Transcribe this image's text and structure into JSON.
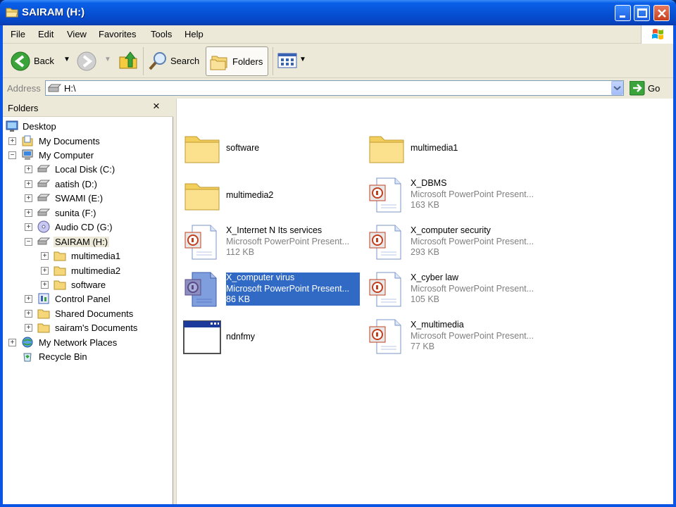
{
  "window": {
    "title": "SAIRAM (H:)"
  },
  "menu": [
    "File",
    "Edit",
    "View",
    "Favorites",
    "Tools",
    "Help"
  ],
  "toolbar": {
    "back_label": "Back",
    "search_label": "Search",
    "folders_label": "Folders"
  },
  "address": {
    "label": "Address",
    "value": "H:\\",
    "go_label": "Go"
  },
  "folders_pane": {
    "title": "Folders",
    "close_glyph": "×",
    "tree": [
      {
        "label": "Desktop",
        "icon": "desktop-icon"
      },
      {
        "label": "My Documents",
        "icon": "my-documents-icon"
      },
      {
        "label": "My Computer",
        "icon": "my-computer-icon"
      },
      {
        "label": "Local Disk (C:)",
        "icon": "drive-icon"
      },
      {
        "label": "aatish (D:)",
        "icon": "drive-icon"
      },
      {
        "label": "SWAMI (E:)",
        "icon": "drive-icon"
      },
      {
        "label": "sunita (F:)",
        "icon": "drive-icon"
      },
      {
        "label": "Audio CD (G:)",
        "icon": "cd-drive-icon"
      },
      {
        "label": "SAIRAM (H:)",
        "icon": "drive-icon"
      },
      {
        "label": "multimedia1",
        "icon": "folder-icon"
      },
      {
        "label": "multimedia2",
        "icon": "folder-icon"
      },
      {
        "label": "software",
        "icon": "folder-icon"
      },
      {
        "label": "Control Panel",
        "icon": "control-panel-icon"
      },
      {
        "label": "Shared Documents",
        "icon": "folder-icon"
      },
      {
        "label": "sairam's Documents",
        "icon": "folder-icon"
      },
      {
        "label": "My Network Places",
        "icon": "network-places-icon"
      },
      {
        "label": "Recycle Bin",
        "icon": "recycle-bin-icon"
      }
    ]
  },
  "files": [
    {
      "name": "software",
      "type": "",
      "size": "",
      "icon": "folder-icon"
    },
    {
      "name": "multimedia1",
      "type": "",
      "size": "",
      "icon": "folder-icon"
    },
    {
      "name": "multimedia2",
      "type": "",
      "size": "",
      "icon": "folder-icon"
    },
    {
      "name": "X_DBMS",
      "type": "Microsoft PowerPoint Present...",
      "size": "163 KB",
      "icon": "powerpoint-file-icon"
    },
    {
      "name": "X_Internet N Its services",
      "type": "Microsoft PowerPoint Present...",
      "size": "112 KB",
      "icon": "powerpoint-file-icon"
    },
    {
      "name": "X_computer security",
      "type": "Microsoft PowerPoint Present...",
      "size": "293 KB",
      "icon": "powerpoint-file-icon"
    },
    {
      "name": "X_computer virus",
      "type": "Microsoft PowerPoint Present...",
      "size": "86 KB",
      "icon": "powerpoint-file-icon"
    },
    {
      "name": "X_cyber law",
      "type": "Microsoft PowerPoint Present...",
      "size": "105 KB",
      "icon": "powerpoint-file-icon"
    },
    {
      "name": "ndnfmy",
      "type": "",
      "size": "",
      "icon": "application-file-icon"
    },
    {
      "name": "X_multimedia",
      "type": "Microsoft PowerPoint Present...",
      "size": "77 KB",
      "icon": "powerpoint-file-icon"
    }
  ],
  "colors": {
    "titlebar": "#0752d6",
    "selection": "#316ac5",
    "chrome": "#ece9d8"
  }
}
